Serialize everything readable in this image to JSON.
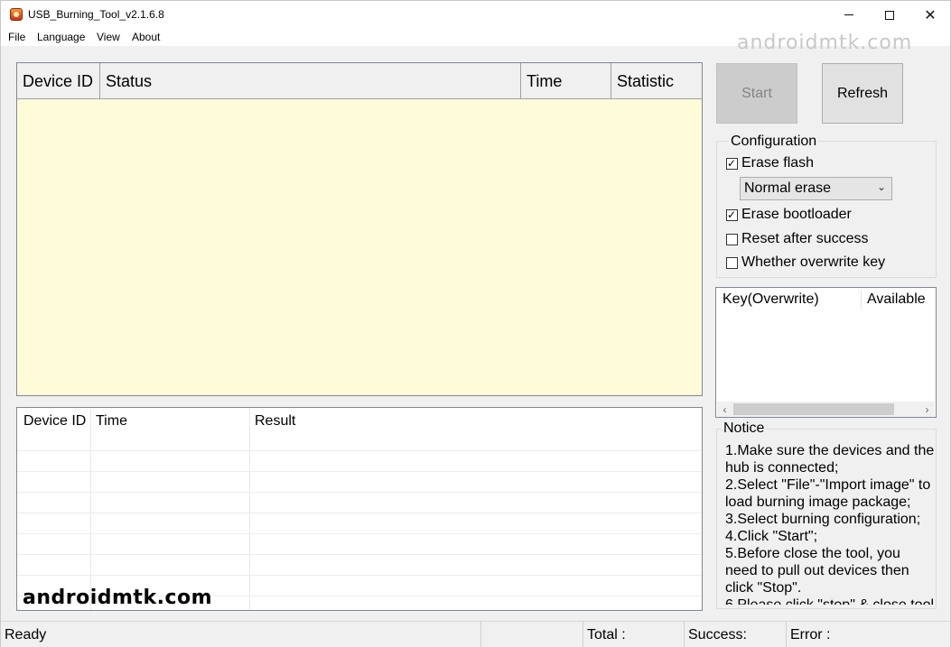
{
  "window": {
    "title": "USB_Burning_Tool_v2.1.6.8"
  },
  "menu": [
    "File",
    "Language",
    "View",
    "About"
  ],
  "watermark": "androidmtk.com",
  "device_table": {
    "columns": [
      "Device ID",
      "Status",
      "Time",
      "Statistic"
    ]
  },
  "result_table": {
    "columns": [
      "Device ID",
      "Time",
      "Result"
    ]
  },
  "buttons": {
    "start": "Start",
    "refresh": "Refresh"
  },
  "configuration": {
    "label": "Configuration",
    "erase_flash": {
      "label": "Erase flash",
      "checked": true
    },
    "erase_mode": {
      "selected": "Normal erase"
    },
    "erase_bootloader": {
      "label": "Erase bootloader",
      "checked": true
    },
    "reset_after_success": {
      "label": "Reset after success",
      "checked": false
    },
    "overwrite_key": {
      "label": "Whether overwrite key",
      "checked": false
    }
  },
  "key_list": {
    "columns": [
      "Key(Overwrite)",
      "Available"
    ]
  },
  "notice": {
    "label": "Notice",
    "text": "1.Make sure the devices and the hub is connected;\n2.Select \"File\"-\"Import image\" to load burning image package;\n3.Select burning configuration;\n4.Click \"Start\";\n5.Before close the tool, you need to pull out devices then click \"Stop\".\n6.Please click \"stop\" & close tool"
  },
  "status_bar": {
    "ready": "Ready",
    "total": "Total :",
    "success": "Success:",
    "error": "Error :"
  },
  "colors": {
    "device_table_bg": "#fefcd8",
    "window_bg": "#f0f0f0"
  }
}
